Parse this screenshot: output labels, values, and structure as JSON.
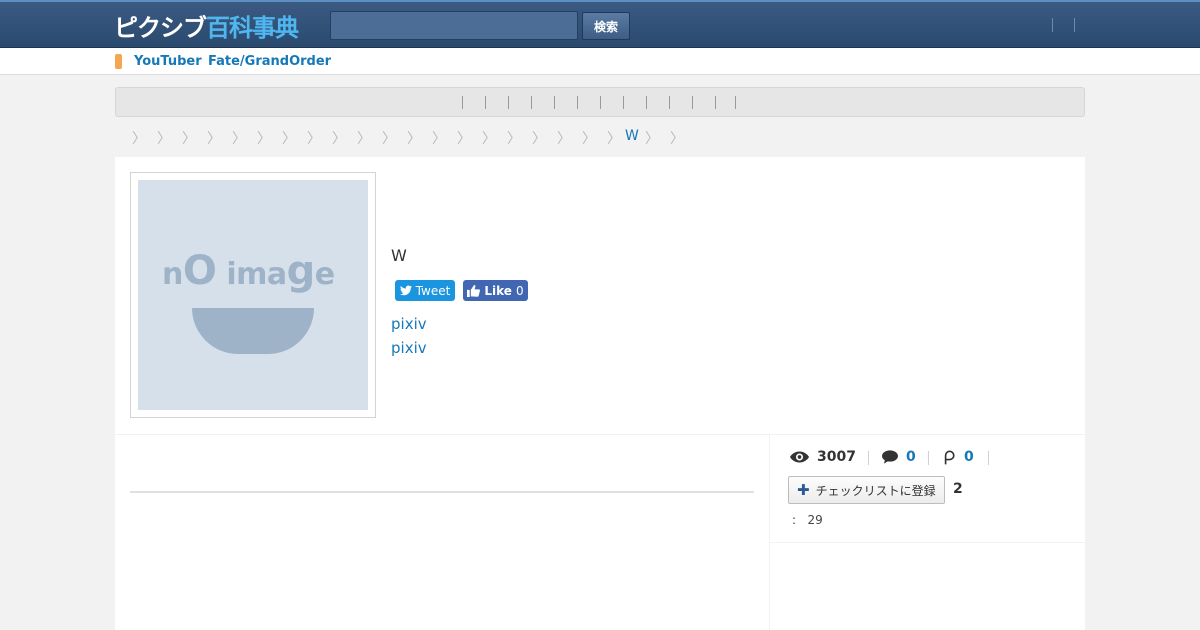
{
  "header": {
    "logo_part1": "ピクシブ",
    "logo_part2": "百科事典",
    "search_placeholder": "",
    "search_button": "検索"
  },
  "subnav": {
    "links": [
      "YouTuber",
      "Fate/GrandOrder"
    ]
  },
  "breadcrumb": {
    "current": "W"
  },
  "article": {
    "title": "W",
    "tweet_label": "Tweet",
    "like_label": "Like",
    "like_count": "0",
    "links": [
      "pixiv",
      "pixiv"
    ]
  },
  "noimage": {
    "text_n": "n",
    "text_o": "O",
    "text_ima": " ima",
    "text_g": "g",
    "text_e": "e"
  },
  "stats": {
    "views": "3007",
    "comments": "0",
    "pics": "0"
  },
  "checklist": {
    "label": "チェックリストに登録",
    "count": "2"
  },
  "misc": {
    "label": ":",
    "value": "29"
  },
  "icons": {
    "views": "eye-icon",
    "comments": "comment-icon",
    "pics": "pin-icon",
    "add": "plus-icon",
    "twitter": "twitter-bird-icon",
    "like": "thumbs-up-icon"
  },
  "colors": {
    "header": "#2f4f76",
    "link": "#1778b8",
    "tweet": "#1b95e0",
    "like": "#4267b2",
    "marker": "#f5a650"
  }
}
